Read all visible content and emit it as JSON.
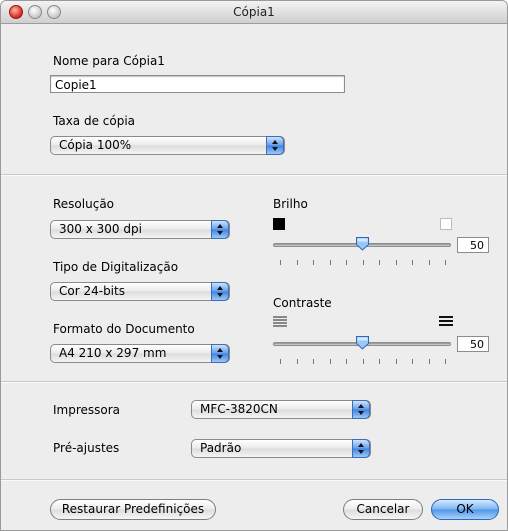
{
  "window": {
    "title": "Cópia1"
  },
  "name_section": {
    "label": "Nome para Cópia1",
    "value": "Copie1"
  },
  "rate_section": {
    "label": "Taxa de cópia",
    "selected": "Cópia 100%"
  },
  "resolution": {
    "label": "Resolução",
    "selected": "300 x 300 dpi"
  },
  "scan_type": {
    "label": "Tipo de Digitalização",
    "selected": "Cor 24-bits"
  },
  "doc_format": {
    "label": "Formato do Documento",
    "selected": "A4 210 x 297 mm"
  },
  "brightness": {
    "label": "Brilho",
    "value": "50",
    "level": 0.5,
    "icon_low": "black-square-icon",
    "icon_high": "white-square-icon"
  },
  "contrast": {
    "label": "Contraste",
    "value": "50",
    "level": 0.5,
    "icon_low": "low-contrast-icon",
    "icon_high": "high-contrast-icon"
  },
  "printer": {
    "label": "Impressora",
    "selected": "MFC-3820CN"
  },
  "presets": {
    "label": "Pré-ajustes",
    "selected": "Padrão"
  },
  "buttons": {
    "restore": "Restaurar Predefinições",
    "cancel": "Cancelar",
    "ok": "OK"
  },
  "colors": {
    "accent": "#4d96ea",
    "window_bg": "#ededed"
  }
}
